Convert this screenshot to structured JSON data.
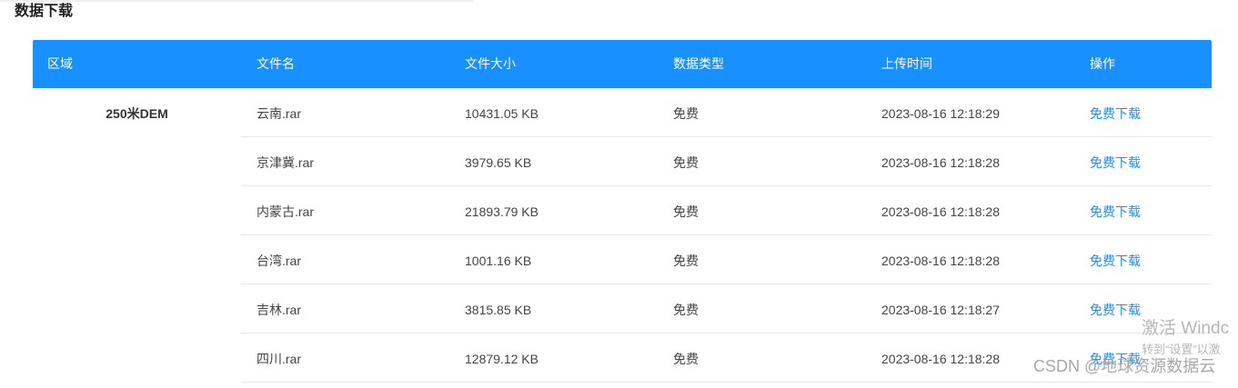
{
  "page": {
    "title": "数据下载"
  },
  "table": {
    "headers": [
      "区域",
      "文件名",
      "文件大小",
      "数据类型",
      "上传时间",
      "操作"
    ],
    "region": "250米DEM",
    "rows": [
      {
        "name": "云南.rar",
        "size": "10431.05 KB",
        "type": "免费",
        "time": "2023-08-16 12:18:29",
        "action": "免费下载"
      },
      {
        "name": "京津冀.rar",
        "size": "3979.65 KB",
        "type": "免费",
        "time": "2023-08-16 12:18:28",
        "action": "免费下载"
      },
      {
        "name": "内蒙古.rar",
        "size": "21893.79 KB",
        "type": "免费",
        "time": "2023-08-16 12:18:28",
        "action": "免费下载"
      },
      {
        "name": "台湾.rar",
        "size": "1001.16 KB",
        "type": "免费",
        "time": "2023-08-16 12:18:28",
        "action": "免费下载"
      },
      {
        "name": "吉林.rar",
        "size": "3815.85 KB",
        "type": "免费",
        "time": "2023-08-16 12:18:27",
        "action": "免费下载"
      },
      {
        "name": "四川.rar",
        "size": "12879.12 KB",
        "type": "免费",
        "time": "2023-08-16 12:18:28",
        "action": "免费下载"
      }
    ]
  },
  "overlay": {
    "activate_line1": "激活 Windc",
    "activate_line2": "转到“设置”以激",
    "watermark": "CSDN @地球资源数据云"
  },
  "colors": {
    "header_bg": "#1890ff",
    "link": "#1890ff",
    "border": "#e8e8e8"
  }
}
